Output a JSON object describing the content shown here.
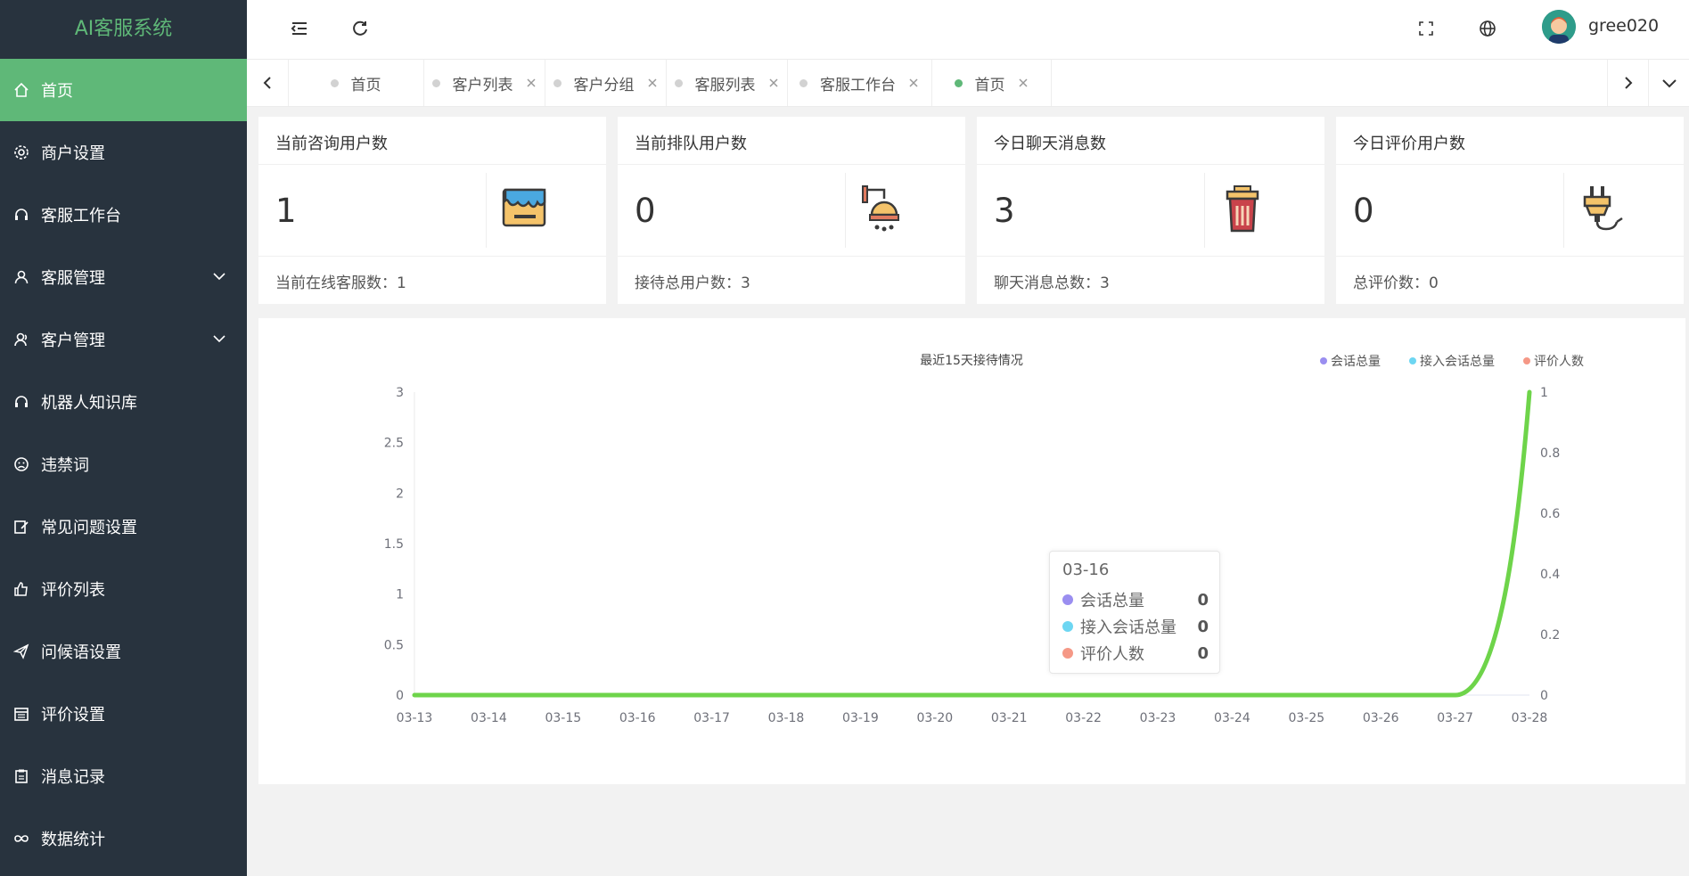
{
  "app": {
    "title": "AI客服系统"
  },
  "sidebar": {
    "items": [
      {
        "label": "首页",
        "icon": "home-icon"
      },
      {
        "label": "商户设置",
        "icon": "gear-icon"
      },
      {
        "label": "客服工作台",
        "icon": "headset-icon"
      },
      {
        "label": "客服管理",
        "icon": "user-icon",
        "expandable": true
      },
      {
        "label": "客户管理",
        "icon": "user-outline-icon",
        "expandable": true
      },
      {
        "label": "机器人知识库",
        "icon": "headset-icon"
      },
      {
        "label": "违禁词",
        "icon": "sad-face-icon"
      },
      {
        "label": "常见问题设置",
        "icon": "edit-icon"
      },
      {
        "label": "评价列表",
        "icon": "thumbs-up-icon"
      },
      {
        "label": "问候语设置",
        "icon": "send-icon"
      },
      {
        "label": "评价设置",
        "icon": "calendar-icon"
      },
      {
        "label": "消息记录",
        "icon": "clipboard-icon"
      },
      {
        "label": "数据统计",
        "icon": "infinity-icon"
      }
    ]
  },
  "topbar": {
    "username": "gree020"
  },
  "tabs": [
    {
      "label": "首页",
      "active": false,
      "closable": false
    },
    {
      "label": "客户列表",
      "active": false,
      "closable": true
    },
    {
      "label": "客户分组",
      "active": false,
      "closable": true
    },
    {
      "label": "客服列表",
      "active": false,
      "closable": true
    },
    {
      "label": "客服工作台",
      "active": false,
      "closable": true
    },
    {
      "label": "首页",
      "active": true,
      "closable": true
    }
  ],
  "cards": [
    {
      "title": "当前咨询用户数",
      "value": "1",
      "footer": "当前在线客服数：1",
      "icon": "paint-bucket-icon"
    },
    {
      "title": "当前排队用户数",
      "value": "0",
      "footer": "接待总用户数：3",
      "icon": "shower-icon"
    },
    {
      "title": "今日聊天消息数",
      "value": "3",
      "footer": "聊天消息总数：3",
      "icon": "trash-bin-icon"
    },
    {
      "title": "今日评价用户数",
      "value": "0",
      "footer": "总评价数：0",
      "icon": "plug-icon"
    }
  ],
  "chart_data": {
    "type": "line",
    "title": "最近15天接待情况",
    "categories": [
      "03-13",
      "03-14",
      "03-15",
      "03-16",
      "03-17",
      "03-18",
      "03-19",
      "03-20",
      "03-21",
      "03-22",
      "03-23",
      "03-24",
      "03-25",
      "03-26",
      "03-27",
      "03-28"
    ],
    "series": [
      {
        "name": "会话总量",
        "color": "#9a8ef0",
        "axis": "left",
        "values": [
          0,
          0,
          0,
          0,
          0,
          0,
          0,
          0,
          0,
          0,
          0,
          0,
          0,
          0,
          0,
          0
        ]
      },
      {
        "name": "接入会话总量",
        "color": "#6dd6f2",
        "axis": "right",
        "values": [
          0,
          0,
          0,
          0,
          0,
          0,
          0,
          0,
          0,
          0,
          0,
          0,
          0,
          0,
          0,
          1
        ]
      },
      {
        "name": "评价人数",
        "color": "#f59886",
        "axis": "left",
        "values": [
          0,
          0,
          0,
          0,
          0,
          0,
          0,
          0,
          0,
          0,
          0,
          0,
          0,
          0,
          0,
          0
        ]
      }
    ],
    "y_left": {
      "min": 0,
      "max": 3,
      "ticks": [
        "0",
        "0.5",
        "1",
        "1.5",
        "2",
        "2.5",
        "3"
      ]
    },
    "y_right": {
      "min": 0,
      "max": 1,
      "ticks": [
        "0",
        "0.2",
        "0.4",
        "0.6",
        "0.8",
        "1"
      ]
    },
    "legend_position": "top-right",
    "grid": false
  },
  "tooltip": {
    "title": "03-16",
    "rows": [
      {
        "name": "会话总量",
        "value": "0",
        "color": "#9a8ef0"
      },
      {
        "name": "接入会话总量",
        "value": "0",
        "color": "#6dd6f2"
      },
      {
        "name": "评价人数",
        "value": "0",
        "color": "#f59886"
      }
    ]
  }
}
